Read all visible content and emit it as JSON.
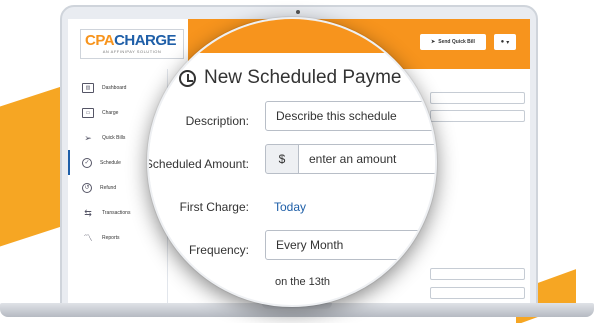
{
  "brand": {
    "logo_cpa": "CPA",
    "logo_charge": "CHARGE",
    "logo_sub": "AN AFFINIPAY SOLUTION",
    "accent": "#f7941d",
    "primary": "#1f5fa8"
  },
  "header": {
    "send_quick_bill_label": "Send Quick Bill",
    "send_icon": "paper-plane-icon",
    "user_icon": "user-icon",
    "user_caret": "▾"
  },
  "sidebar": {
    "items": [
      {
        "label": "Dashboard",
        "icon": "bar-chart-icon"
      },
      {
        "label": "Charge",
        "icon": "card-icon"
      },
      {
        "label": "Quick Bills",
        "icon": "paper-plane-icon"
      },
      {
        "label": "Schedule",
        "icon": "clock-icon",
        "active": true
      },
      {
        "label": "Refund",
        "icon": "refund-icon"
      },
      {
        "label": "Transactions",
        "icon": "transfer-icon"
      },
      {
        "label": "Reports",
        "icon": "line-chart-icon"
      }
    ]
  },
  "form": {
    "title": "New Scheduled Payme",
    "description_label": "Description:",
    "description_placeholder": "Describe this schedule",
    "amount_label": "Scheduled Amount:",
    "currency_symbol": "$",
    "amount_placeholder": "enter an amount",
    "first_charge_label": "First Charge:",
    "first_charge_value": "Today",
    "frequency_label": "Frequency:",
    "frequency_value": "Every Month",
    "frequency_note": "on the 13th"
  }
}
